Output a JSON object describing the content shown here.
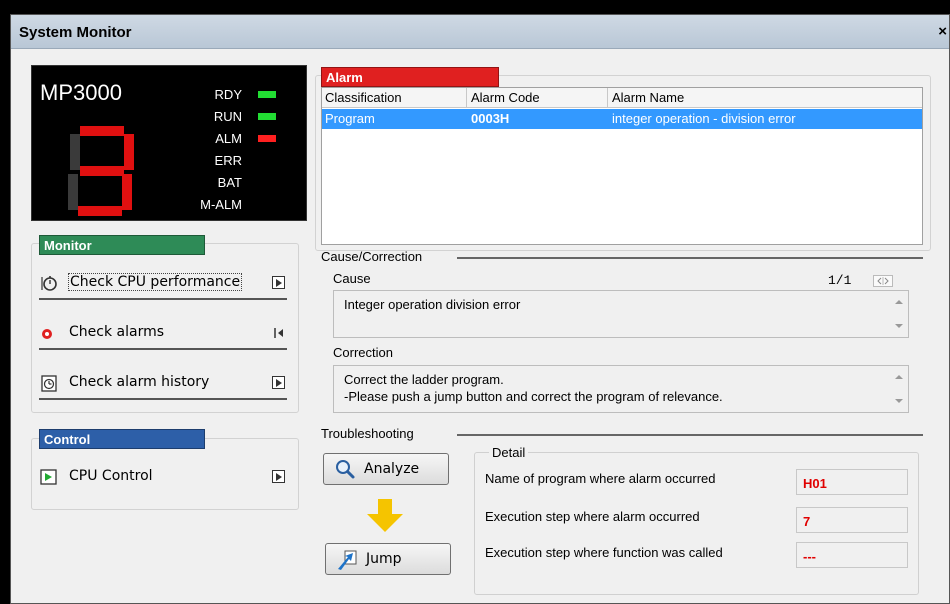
{
  "window": {
    "title": "System Monitor",
    "close_glyph": "×"
  },
  "status_panel": {
    "model": "MP3000",
    "digit": "8",
    "leds": [
      {
        "label": "RDY",
        "color": "#22dd33",
        "lit": true
      },
      {
        "label": "RUN",
        "color": "#22dd33",
        "lit": true
      },
      {
        "label": "ALM",
        "color": "#ff2020",
        "lit": true
      },
      {
        "label": "ERR",
        "lit": false
      },
      {
        "label": "BAT",
        "lit": false
      },
      {
        "label": "M-ALM",
        "lit": false
      }
    ]
  },
  "monitor_group": {
    "title": "Monitor",
    "accent": "#2e8b57",
    "items": [
      {
        "label": "Check CPU performance",
        "icon": "stopwatch-icon"
      },
      {
        "label": "Check alarms",
        "icon": "red-dot-icon"
      },
      {
        "label": "Check alarm history",
        "icon": "history-clock-icon"
      }
    ]
  },
  "control_group": {
    "title": "Control",
    "accent": "#2d5fa8",
    "items": [
      {
        "label": "CPU Control",
        "icon": "cpu-control-icon"
      }
    ]
  },
  "alarm_group": {
    "title": "Alarm",
    "accent": "#e02020",
    "columns": [
      "Classification",
      "Alarm Code",
      "Alarm Name"
    ],
    "rows": [
      {
        "classification": "Program",
        "code": "0003H",
        "name": "integer operation - division error"
      }
    ]
  },
  "cause_correction": {
    "section_label": "Cause/Correction",
    "cause_label": "Cause",
    "page": "1/1",
    "cause_text": "Integer operation division error",
    "correction_label": "Correction",
    "correction_lines": [
      "Correct the ladder program.",
      "-Please push a jump button and correct the program of relevance."
    ]
  },
  "troubleshooting": {
    "section_label": "Troubleshooting",
    "analyze_label": "Analyze",
    "jump_label": "Jump",
    "arrow_color": "#f5c400",
    "detail_title": "Detail",
    "details": [
      {
        "label": "Name of program where alarm occurred",
        "value": "H01"
      },
      {
        "label": "Execution step where alarm occurred",
        "value": "7"
      },
      {
        "label": "Execution step where function was called",
        "value": "---"
      }
    ]
  }
}
